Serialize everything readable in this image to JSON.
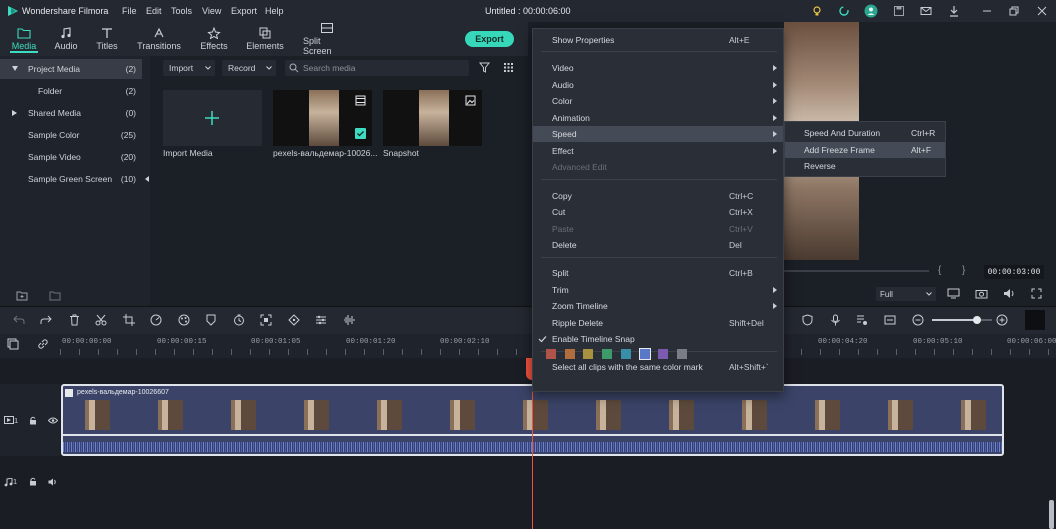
{
  "app": {
    "name": "Wondershare Filmora",
    "doc_title": "Untitled : 00:00:06:00",
    "menu": [
      "File",
      "Edit",
      "Tools",
      "View",
      "Export",
      "Help"
    ]
  },
  "tabs": [
    {
      "label": "Media",
      "icon": "folder-icon"
    },
    {
      "label": "Audio",
      "icon": "music-note-icon"
    },
    {
      "label": "Titles",
      "icon": "text-t-icon"
    },
    {
      "label": "Transitions",
      "icon": "transition-icon"
    },
    {
      "label": "Effects",
      "icon": "effects-icon"
    },
    {
      "label": "Elements",
      "icon": "elements-icon"
    },
    {
      "label": "Split Screen",
      "icon": "split-screen-icon"
    }
  ],
  "export_label": "Export",
  "library": [
    {
      "label": "Project Media",
      "count": "(2)"
    },
    {
      "label": "Folder",
      "count": "(2)"
    },
    {
      "label": "Shared Media",
      "count": "(0)"
    },
    {
      "label": "Sample Color",
      "count": "(25)"
    },
    {
      "label": "Sample Video",
      "count": "(20)"
    },
    {
      "label": "Sample Green Screen",
      "count": "(10)"
    }
  ],
  "media_toolbar": {
    "import_label": "Import",
    "record_label": "Record",
    "search_placeholder": "Search media"
  },
  "media_items": [
    {
      "caption": "Import Media"
    },
    {
      "caption": "pexels-вальдемар-10026..."
    },
    {
      "caption": "Snapshot"
    }
  ],
  "preview": {
    "time": "00:00:03:00",
    "quality": "Full"
  },
  "ruler_ticks": [
    "00:00:00:00",
    "00:00:00:15",
    "00:00:01:05",
    "00:00:01:20",
    "00:00:02:10",
    "00:00:04:20",
    "00:00:05:10",
    "00:00:06:00"
  ],
  "timeline": {
    "clip_name": "pexels-вальдемар-10026607",
    "video_track": "1",
    "audio_track": "1"
  },
  "context_menu": {
    "items": [
      {
        "label": "Show Properties",
        "shortcut": "Alt+E"
      },
      {
        "label": "Video",
        "shortcut": ""
      },
      {
        "label": "Audio",
        "shortcut": ""
      },
      {
        "label": "Color",
        "shortcut": ""
      },
      {
        "label": "Animation",
        "shortcut": ""
      },
      {
        "label": "Speed",
        "shortcut": ""
      },
      {
        "label": "Effect",
        "shortcut": ""
      },
      {
        "label": "Advanced Edit",
        "shortcut": ""
      },
      {
        "label": "Copy",
        "shortcut": "Ctrl+C"
      },
      {
        "label": "Cut",
        "shortcut": "Ctrl+X"
      },
      {
        "label": "Paste",
        "shortcut": "Ctrl+V"
      },
      {
        "label": "Delete",
        "shortcut": "Del"
      },
      {
        "label": "Split",
        "shortcut": "Ctrl+B"
      },
      {
        "label": "Trim",
        "shortcut": ""
      },
      {
        "label": "Zoom Timeline",
        "shortcut": ""
      },
      {
        "label": "Ripple Delete",
        "shortcut": "Shift+Del"
      },
      {
        "label": "Enable Timeline Snap",
        "shortcut": ""
      },
      {
        "label": "Select all clips with the same color mark",
        "shortcut": "Alt+Shift+`"
      }
    ],
    "color_marks": [
      "#b0544a",
      "#b06d3f",
      "#a8923f",
      "#3f9a6b",
      "#3a8fa8",
      "#5a78c8",
      "#7b5ab0",
      "#7a7d84"
    ]
  },
  "speed_submenu": {
    "items": [
      {
        "label": "Speed And Duration",
        "shortcut": "Ctrl+R"
      },
      {
        "label": "Add Freeze Frame",
        "shortcut": "Alt+F"
      },
      {
        "label": "Reverse",
        "shortcut": ""
      }
    ]
  }
}
